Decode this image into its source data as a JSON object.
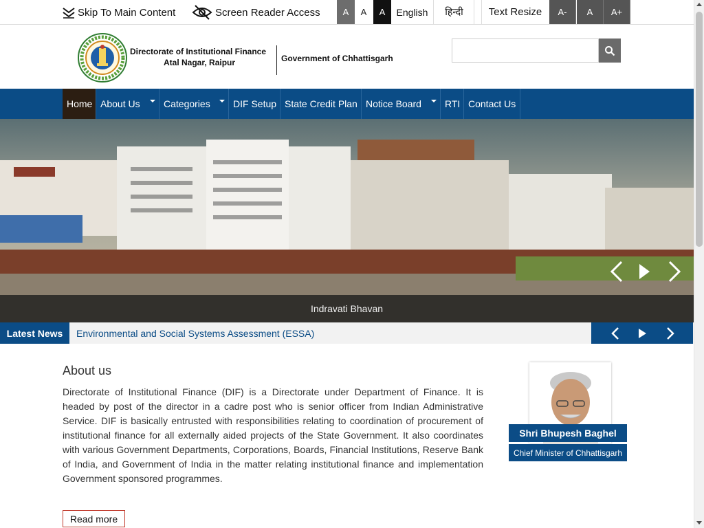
{
  "topbar": {
    "skip_label": "Skip To Main Content",
    "screen_reader_label": "Screen Reader Access",
    "contrast": [
      "A",
      "A",
      "A"
    ],
    "lang_english": "English",
    "lang_hindi": "हिन्दी",
    "text_resize_label": "Text Resize",
    "resize": [
      "A-",
      "A",
      "A+"
    ]
  },
  "header": {
    "org_line1": "Directorate of Institutional Finance",
    "org_line2": "Atal Nagar, Raipur",
    "government": "Government of Chhattisgarh",
    "search": {
      "placeholder": "",
      "value": ""
    }
  },
  "nav": {
    "items": [
      {
        "label": "Home",
        "active": true
      },
      {
        "label": "About Us",
        "dropdown": true
      },
      {
        "label": "Categories",
        "dropdown": true
      },
      {
        "label": "DIF Setup"
      },
      {
        "label": "State Credit Plan"
      },
      {
        "label": "Notice Board",
        "dropdown": true
      },
      {
        "label": "RTI"
      },
      {
        "label": "Contact Us"
      }
    ]
  },
  "slider": {
    "caption": "Indravati Bhavan"
  },
  "news": {
    "label": "Latest News",
    "item": "Environmental and Social Systems Assessment (ESSA)"
  },
  "about": {
    "title": "About us",
    "text": "Directorate of Institutional Finance (DIF) is a Directorate under Department of Finance. It is headed by post of the director in a cadre post who is senior officer from Indian Administrative Service. DIF is basically entrusted with responsibilities relating to coordination of procurement of institutional finance for all externally aided projects of the State Government. It also coordinates with various Government Departments, Corporations, Boards, Financial Institutions, Reserve Bank of India, and Government of India in the matter relating institutional finance and implementation Government sponsored programmes.",
    "read_more": "Read more"
  },
  "cm": {
    "name": "Shri Bhupesh Baghel",
    "title": "Chief Minister of Chhattisgarh"
  },
  "colors": {
    "primary_blue": "#0b4c86",
    "active_nav": "#2c1e12",
    "read_more_border": "#c0392b"
  }
}
